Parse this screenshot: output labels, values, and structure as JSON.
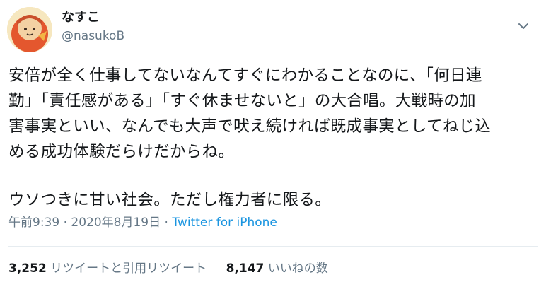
{
  "author": {
    "display_name": "なすこ",
    "handle": "@nasukoB"
  },
  "tweet": {
    "lines": [
      "安倍が全く仕事してないなんてすぐにわかることなのに、「何日連",
      "勤」「責任感がある」「すぐ休ませないと」の大合唱。大戦時の加",
      "害事実といい、なんでも大声で吠え続ければ既成事実としてねじ込",
      "める成功体験だらけだからね。",
      "ウソつきに甘い社会。ただし権力者に限る。"
    ]
  },
  "meta": {
    "time": "午前9:39",
    "separator1": " · ",
    "date": "2020年8月19日",
    "separator2": " · ",
    "source": "Twitter for iPhone"
  },
  "stats": {
    "retweets_count": "3,252",
    "retweets_label": " リツイートと引用リツイート",
    "likes_count": "8,147",
    "likes_label": " いいねの数"
  },
  "icons": {
    "menu": "chevron-down-icon",
    "avatar": "avatar-illustration"
  },
  "colors": {
    "text": "#14171a",
    "secondary": "#657786",
    "link": "#1b95e0",
    "divider": "#e6ecf0"
  }
}
